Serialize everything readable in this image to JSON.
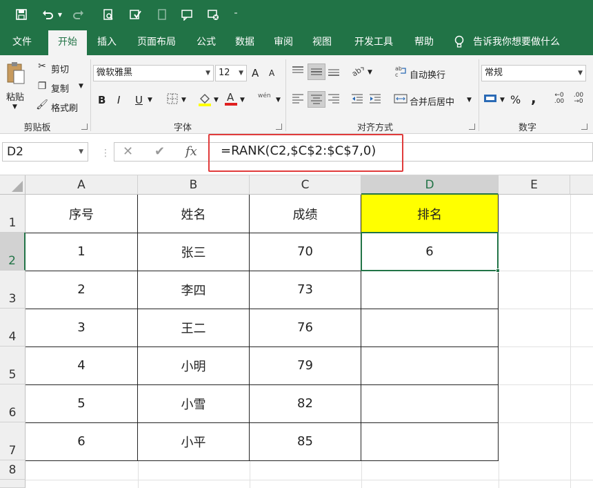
{
  "colors": {
    "accent": "#217346",
    "highlight": "#ffff00",
    "annotation": "#e03a3a"
  },
  "quick_access": [
    "save-icon",
    "undo-icon",
    "redo-icon",
    "print-preview-icon",
    "spellcheck-icon",
    "touch-mode-icon",
    "comment-icon",
    "clear-icon",
    "customize-icon"
  ],
  "tabs": [
    {
      "label": "文件"
    },
    {
      "label": "开始"
    },
    {
      "label": "插入"
    },
    {
      "label": "页面布局"
    },
    {
      "label": "公式"
    },
    {
      "label": "数据"
    },
    {
      "label": "审阅"
    },
    {
      "label": "视图"
    },
    {
      "label": "开发工具"
    },
    {
      "label": "帮助"
    }
  ],
  "tell_me": "告诉我你想要做什么",
  "ribbon": {
    "clipboard": {
      "paste": "粘贴",
      "cut": "剪切",
      "copy": "复制",
      "format_painter": "格式刷",
      "label": "剪贴板"
    },
    "font": {
      "name": "微软雅黑",
      "size": "12",
      "label": "字体",
      "bold": "B",
      "italic": "I",
      "underline": "U",
      "grow": "A",
      "shrink": "A",
      "phonetic": "wén"
    },
    "alignment": {
      "wrap": "自动换行",
      "merge": "合并后居中",
      "label": "对齐方式"
    },
    "number": {
      "format": "常规",
      "percent": "%",
      "comma": ",",
      "label": "数字"
    }
  },
  "formula_bar": {
    "name_box": "D2",
    "cancel": "✕",
    "enter": "✔",
    "fx": "fx",
    "formula": "=RANK(C2,$C$2:$C$7,0)"
  },
  "sheet": {
    "columns": [
      "A",
      "B",
      "C",
      "D",
      "E"
    ],
    "rows": [
      "1",
      "2",
      "3",
      "4",
      "5",
      "6",
      "7",
      "8"
    ],
    "header": [
      "序号",
      "姓名",
      "成绩",
      "排名"
    ],
    "data": [
      [
        "1",
        "张三",
        "70",
        "6"
      ],
      [
        "2",
        "李四",
        "73",
        ""
      ],
      [
        "3",
        "王二",
        "76",
        ""
      ],
      [
        "4",
        "小明",
        "79",
        ""
      ],
      [
        "5",
        "小雪",
        "82",
        ""
      ],
      [
        "6",
        "小平",
        "85",
        ""
      ]
    ]
  }
}
